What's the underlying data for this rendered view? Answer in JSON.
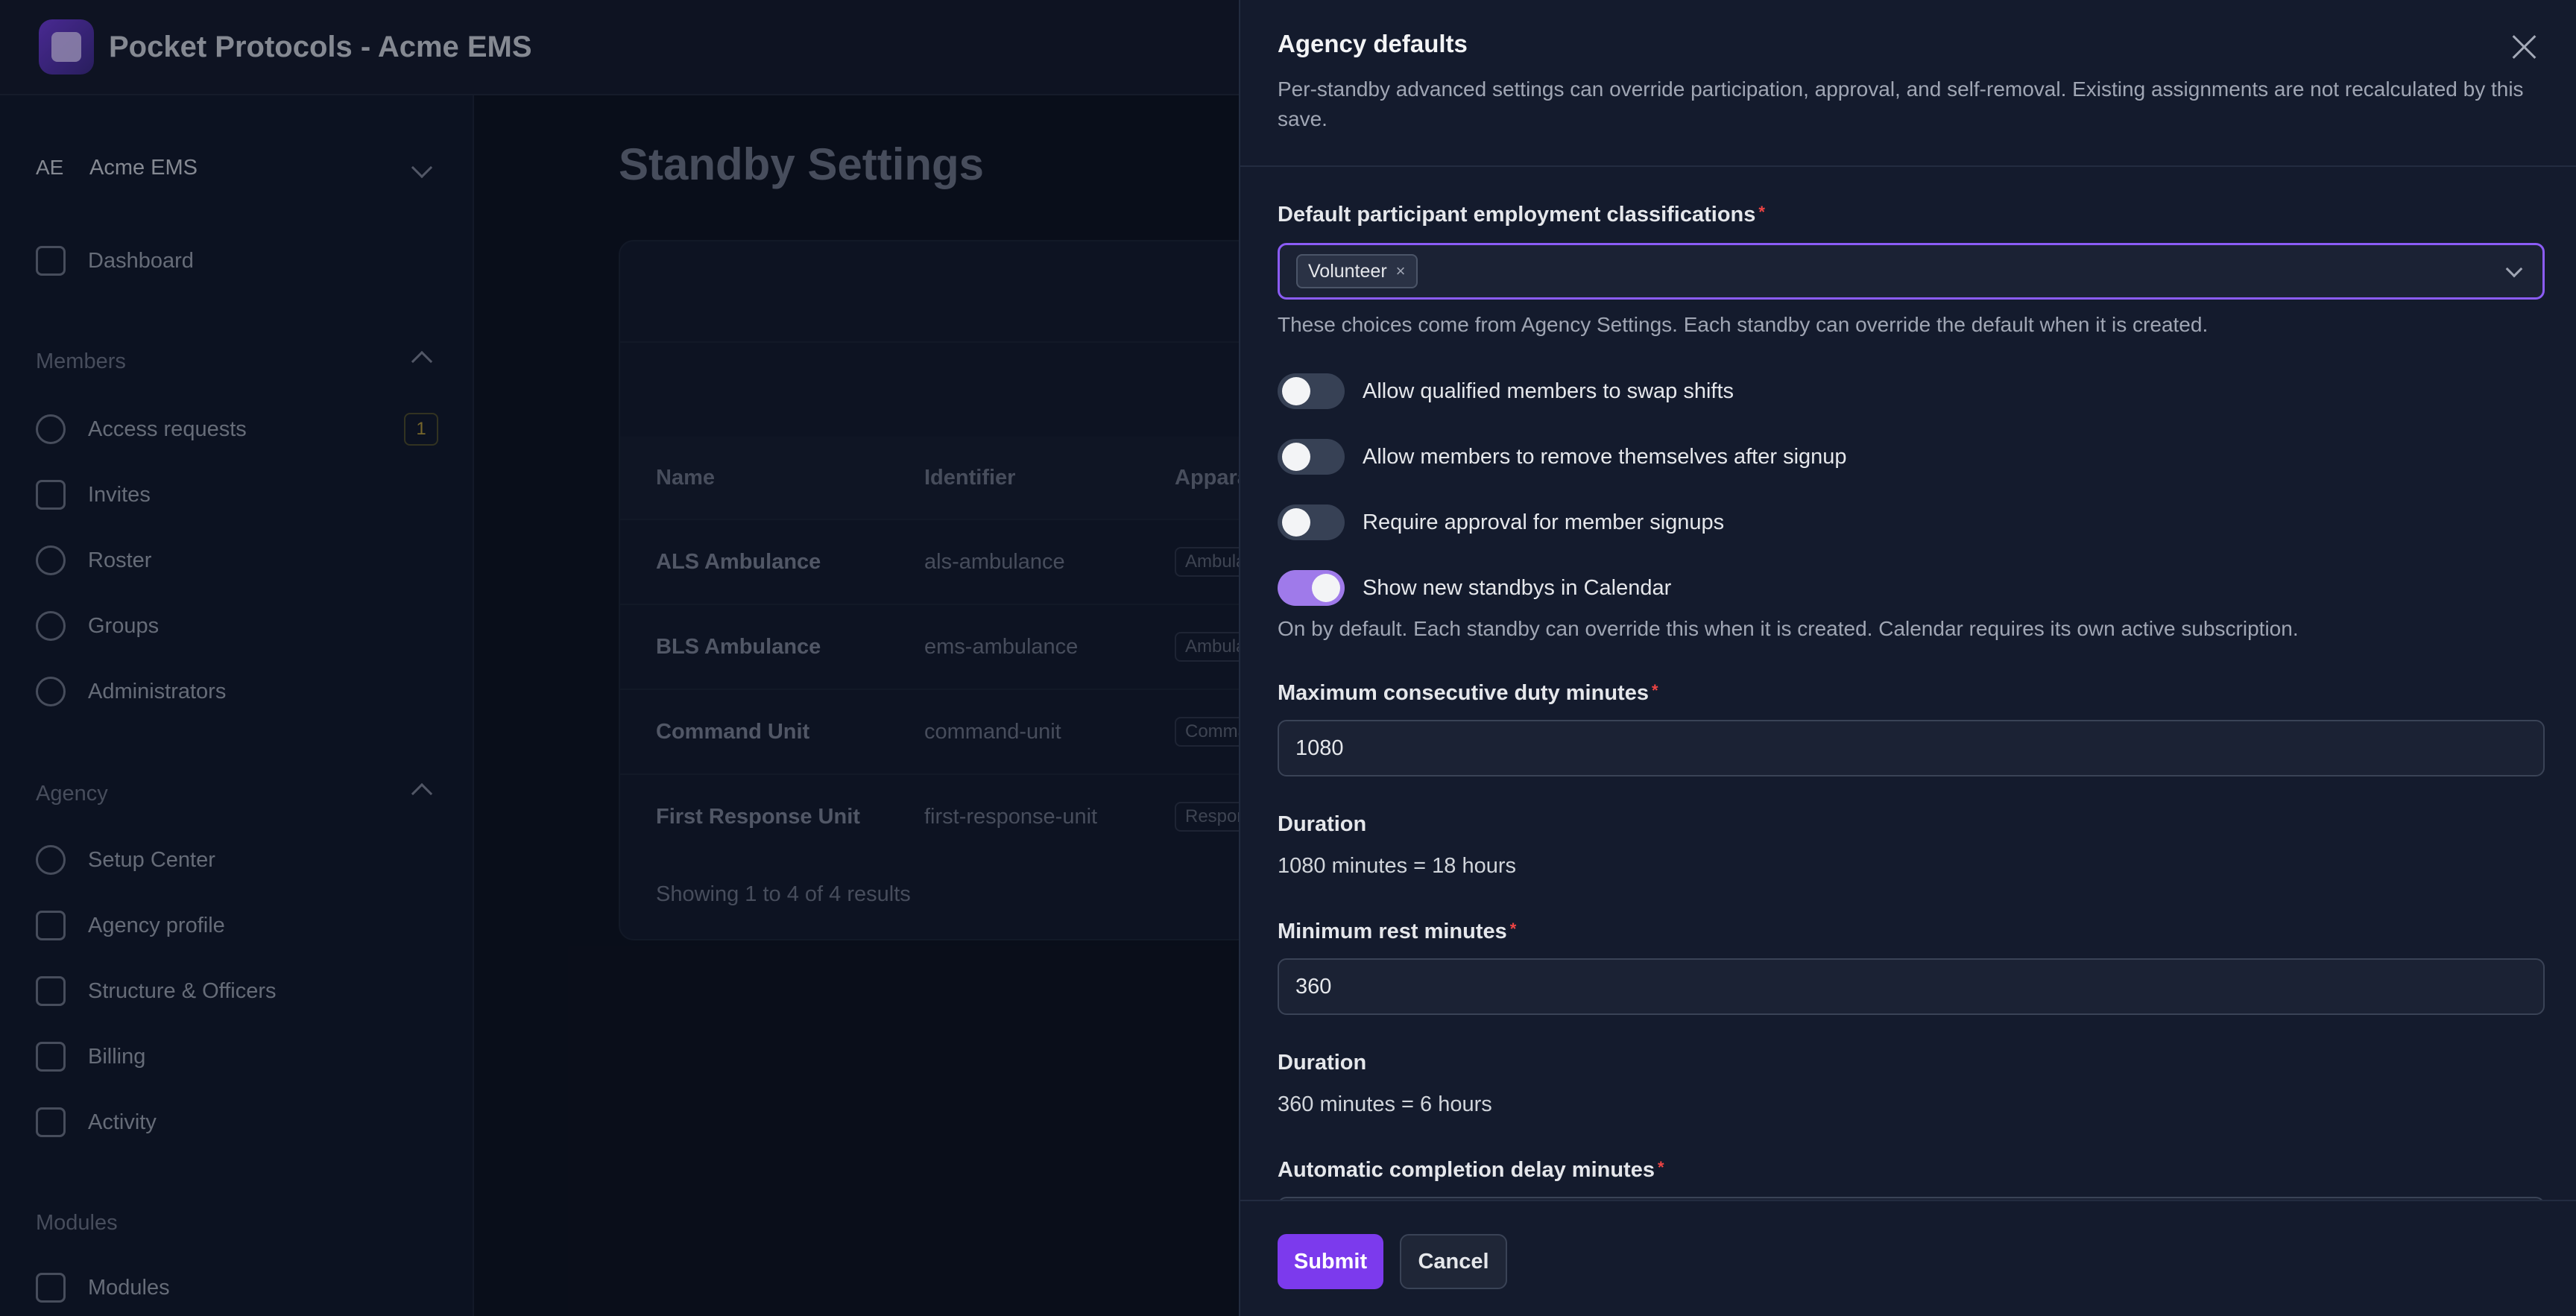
{
  "app": {
    "title": "Pocket Protocols - Acme EMS"
  },
  "tenant": {
    "abbr": "AE",
    "name": "Acme EMS"
  },
  "sidebar": {
    "dashboard": "Dashboard",
    "sections": {
      "members": "Members",
      "agency": "Agency",
      "modules": "Modules"
    },
    "members_items": [
      {
        "label": "Access requests",
        "badge": "1"
      },
      {
        "label": "Invites"
      },
      {
        "label": "Roster"
      },
      {
        "label": "Groups"
      },
      {
        "label": "Administrators"
      }
    ],
    "agency_items": [
      {
        "label": "Setup Center"
      },
      {
        "label": "Agency profile"
      },
      {
        "label": "Structure & Officers"
      },
      {
        "label": "Billing"
      },
      {
        "label": "Activity"
      }
    ],
    "modules_items": [
      {
        "label": "Modules"
      }
    ]
  },
  "main": {
    "title": "Standby Settings",
    "table": {
      "headers": [
        "Name",
        "Identifier",
        "Appara"
      ],
      "rows": [
        {
          "name": "ALS Ambulance",
          "identifier": "als-ambulance",
          "tag": "Ambula"
        },
        {
          "name": "BLS Ambulance",
          "identifier": "ems-ambulance",
          "tag": "Ambula"
        },
        {
          "name": "Command Unit",
          "identifier": "command-unit",
          "tag": "Comma"
        },
        {
          "name": "First Response Unit",
          "identifier": "first-response-unit",
          "tag": "Respor"
        }
      ],
      "footer": "Showing 1 to 4 of 4 results"
    }
  },
  "panel": {
    "title": "Agency defaults",
    "description": "Per-standby advanced settings can override participation, approval, and self-removal. Existing assignments are not recalculated by this save.",
    "classifications": {
      "label": "Default participant employment classifications",
      "required": "*",
      "chip": "Volunteer",
      "chip_remove": "×",
      "hint": "These choices come from Agency Settings. Each standby can override the default when it is created."
    },
    "toggles": [
      {
        "label": "Allow qualified members to swap shifts",
        "on": false
      },
      {
        "label": "Allow members to remove themselves after signup",
        "on": false
      },
      {
        "label": "Require approval for member signups",
        "on": false
      },
      {
        "label": "Show new standbys in Calendar",
        "on": true
      }
    ],
    "calendar_hint": "On by default. Each standby can override this when it is created. Calendar requires its own active subscription.",
    "max_duty": {
      "label": "Maximum consecutive duty minutes",
      "required": "*",
      "value": "1080",
      "duration_label": "Duration",
      "duration_value": "1080 minutes = 18 hours"
    },
    "min_rest": {
      "label": "Minimum rest minutes",
      "required": "*",
      "value": "360",
      "duration_label": "Duration",
      "duration_value": "360 minutes = 6 hours"
    },
    "auto_completion": {
      "label": "Automatic completion delay minutes",
      "required": "*"
    },
    "buttons": {
      "submit": "Submit",
      "cancel": "Cancel"
    }
  }
}
